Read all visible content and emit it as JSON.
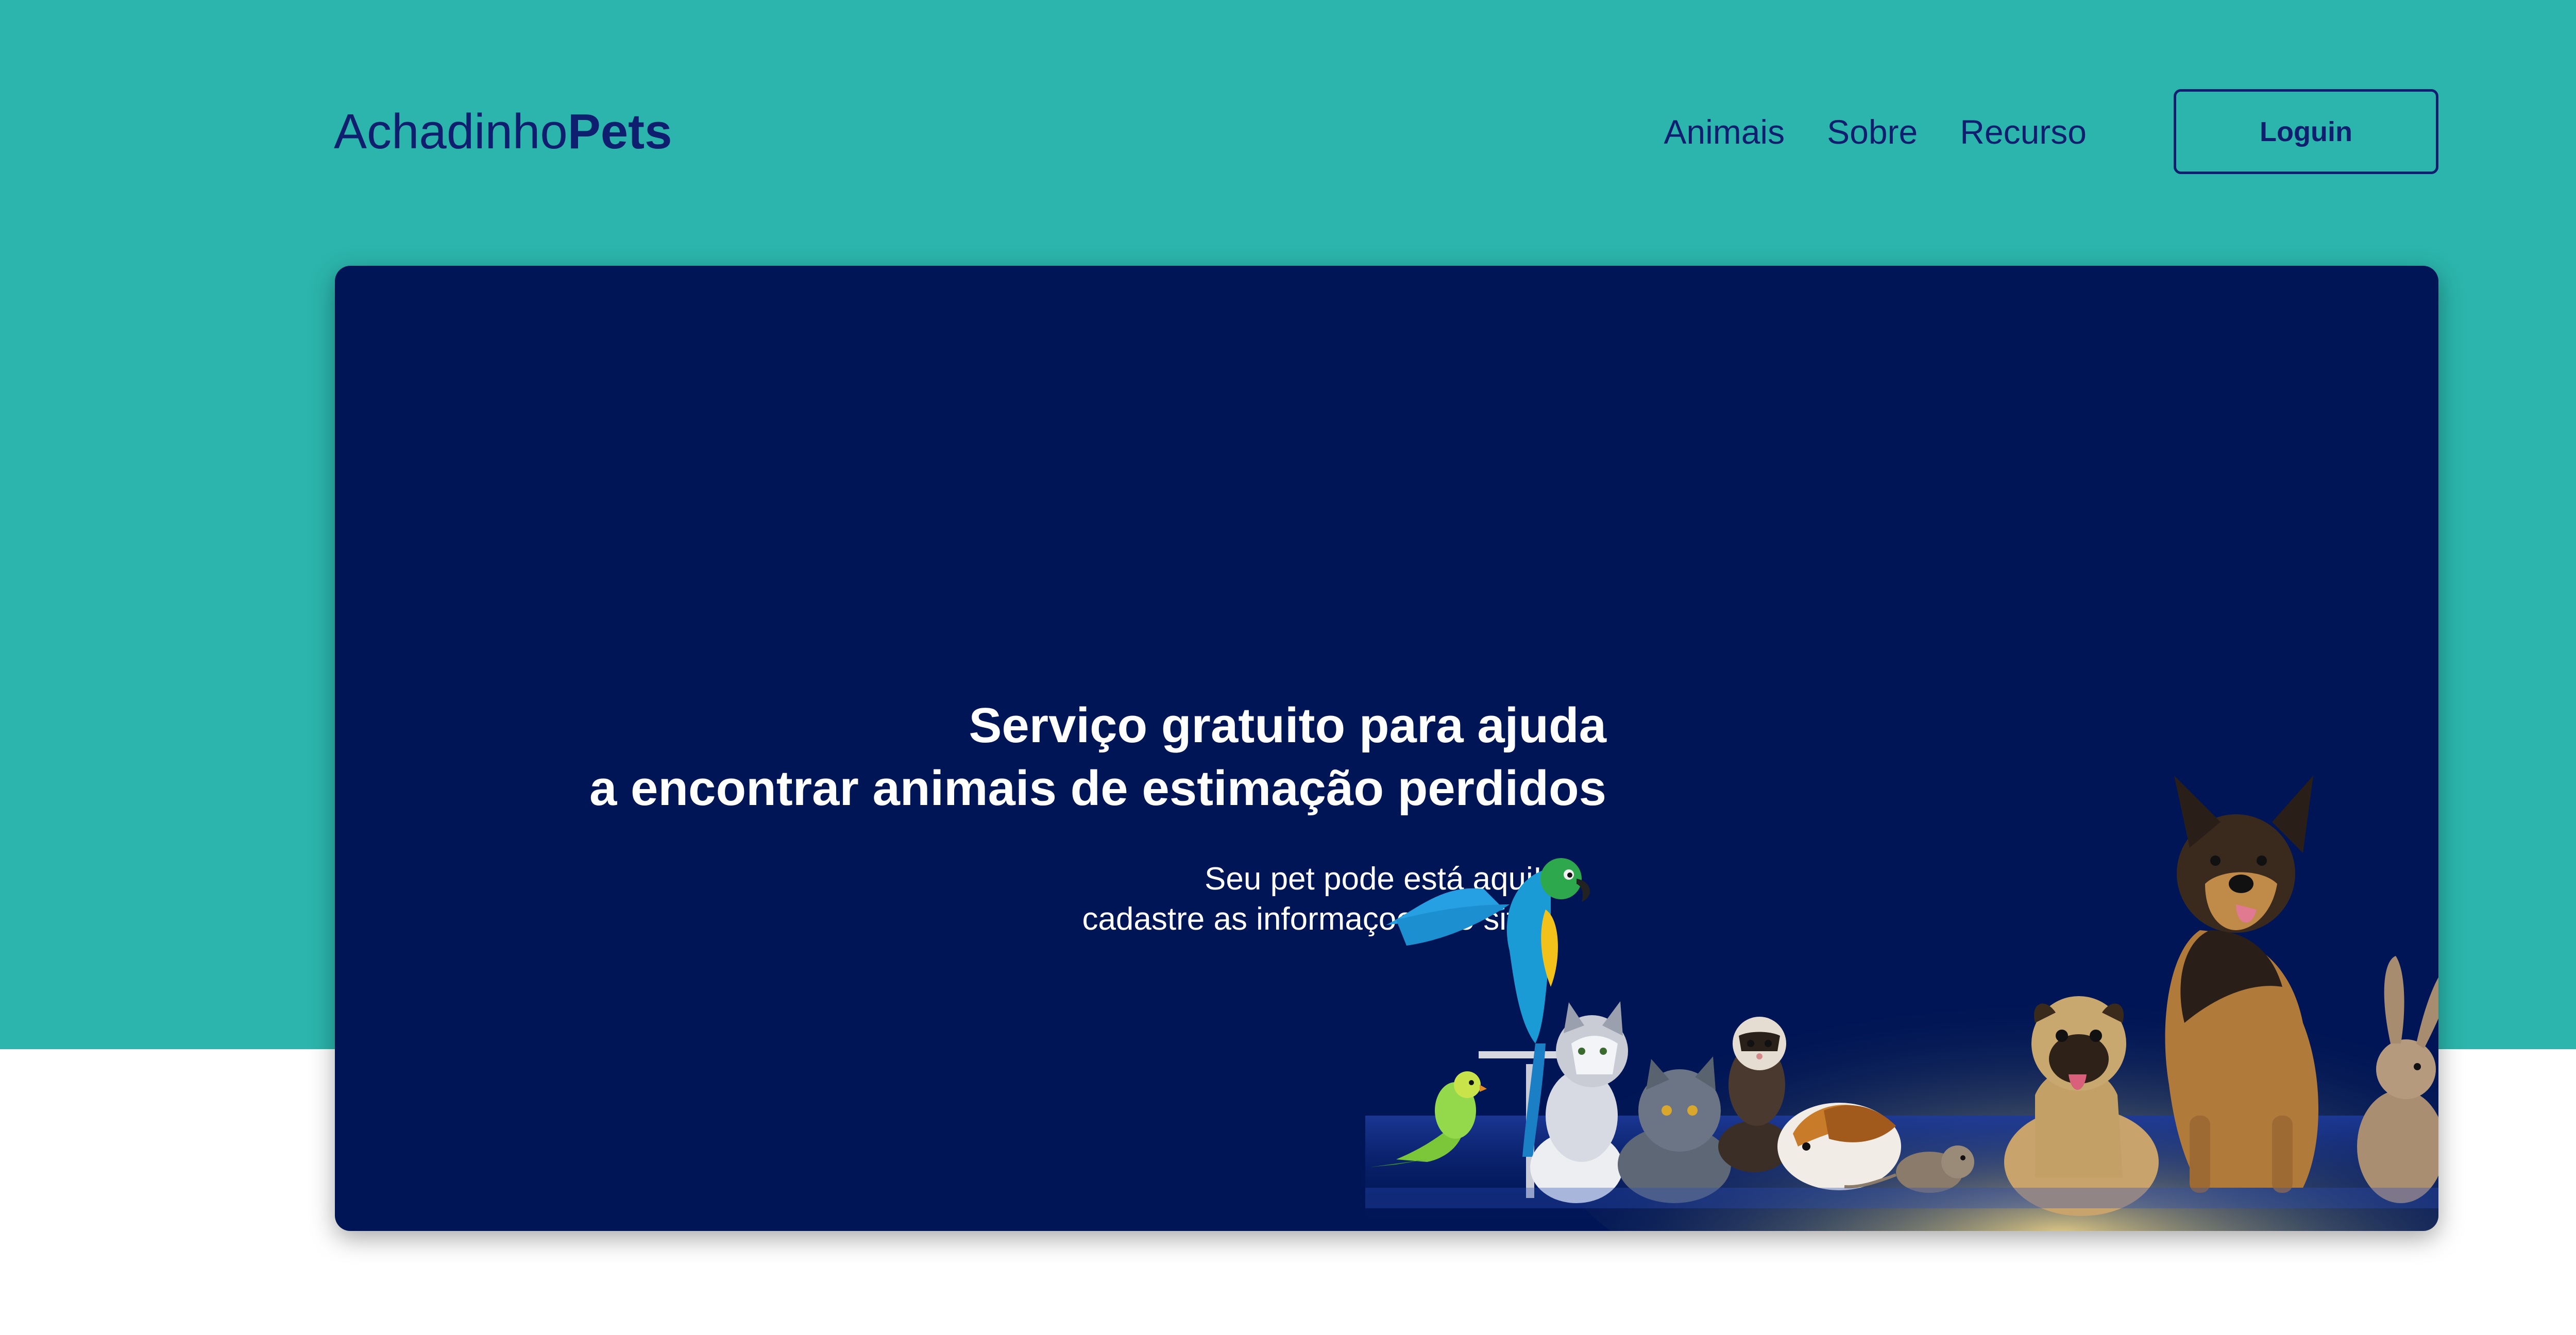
{
  "header": {
    "brand_regular": "Achadinho",
    "brand_bold": "Pets",
    "nav": [
      "Animais",
      "Sobre",
      "Recurso"
    ],
    "login_label": "Loguin"
  },
  "hero": {
    "title_line1": "Serviço gratuito para ajuda",
    "title_line2": "a encontrar animais de estimação perdidos",
    "sub_line1": "Seu pet pode está aqui!",
    "sub_line2": "cadastre as informaçoes no site:"
  },
  "colors": {
    "teal_background": "#2bb5ac",
    "navy": "#0d1f6e",
    "hero_background": "#001555",
    "white": "#ffffff"
  }
}
